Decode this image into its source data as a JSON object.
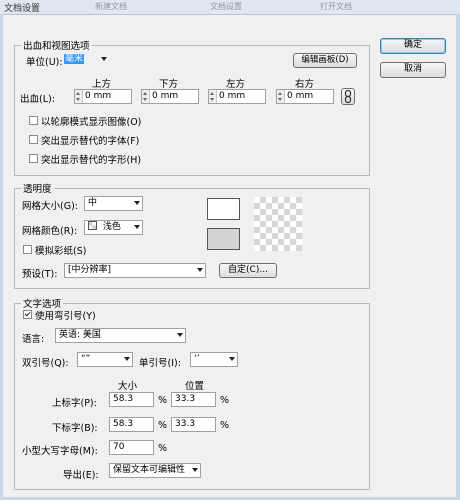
{
  "window": {
    "title": "文档设置",
    "background_tabs": [
      "新建文档",
      "文档设置",
      "打开文档"
    ]
  },
  "buttons": {
    "ok": "确定",
    "cancel": "取消"
  },
  "bleed": {
    "legend": "出血和视图选项",
    "unit_label": "单位(U):",
    "unit_value": "毫米",
    "edit_artboard": "编辑画板(D)",
    "bleed_label": "出血(L):",
    "col_headers": {
      "top": "上方",
      "bottom": "下方",
      "left": "左方",
      "right": "右方"
    },
    "values": {
      "top": "0 mm",
      "bottom": "0 mm",
      "left": "0 mm",
      "right": "0 mm"
    },
    "link_icon": "chain-link-icon",
    "checkboxes": [
      {
        "label": "以轮廓模式显示图像(O)",
        "checked": false
      },
      {
        "label": "突出显示替代的字体(F)",
        "checked": false
      },
      {
        "label": "突出显示替代的字形(H)",
        "checked": false
      }
    ]
  },
  "transparency": {
    "legend": "透明度",
    "grid_size_label": "网格大小(G):",
    "grid_size_value": "中",
    "grid_color_label": "网格颜色(R):",
    "grid_color_value": "浅色",
    "simulate_paper_label": "模拟彩纸(S)",
    "simulate_paper_checked": false,
    "preset_label": "预设(T):",
    "preset_value": "[中分辨率]",
    "custom_button": "自定(C)..."
  },
  "type_options": {
    "legend": "文字选项",
    "use_typographers_quotes_label": "使用弯引号(Y)",
    "use_typographers_quotes_checked": true,
    "language_label": "语言:",
    "language_value": "英语: 美国",
    "double_quotes_label": "双引号(Q):",
    "double_quotes_value": "“”",
    "single_quotes_label": "单引号(I):",
    "single_quotes_value": "‘’",
    "size_header": "大小",
    "position_header": "位置",
    "superscript_label": "上标字(P):",
    "superscript_size": "58.3",
    "superscript_position": "33.3",
    "subscript_label": "下标字(B):",
    "subscript_size": "58.3",
    "subscript_position": "33.3",
    "small_caps_label": "小型大写字母(M):",
    "small_caps_value": "70",
    "percent": "%",
    "export_label": "导出(E):",
    "export_value": "保留文本可编辑性"
  }
}
